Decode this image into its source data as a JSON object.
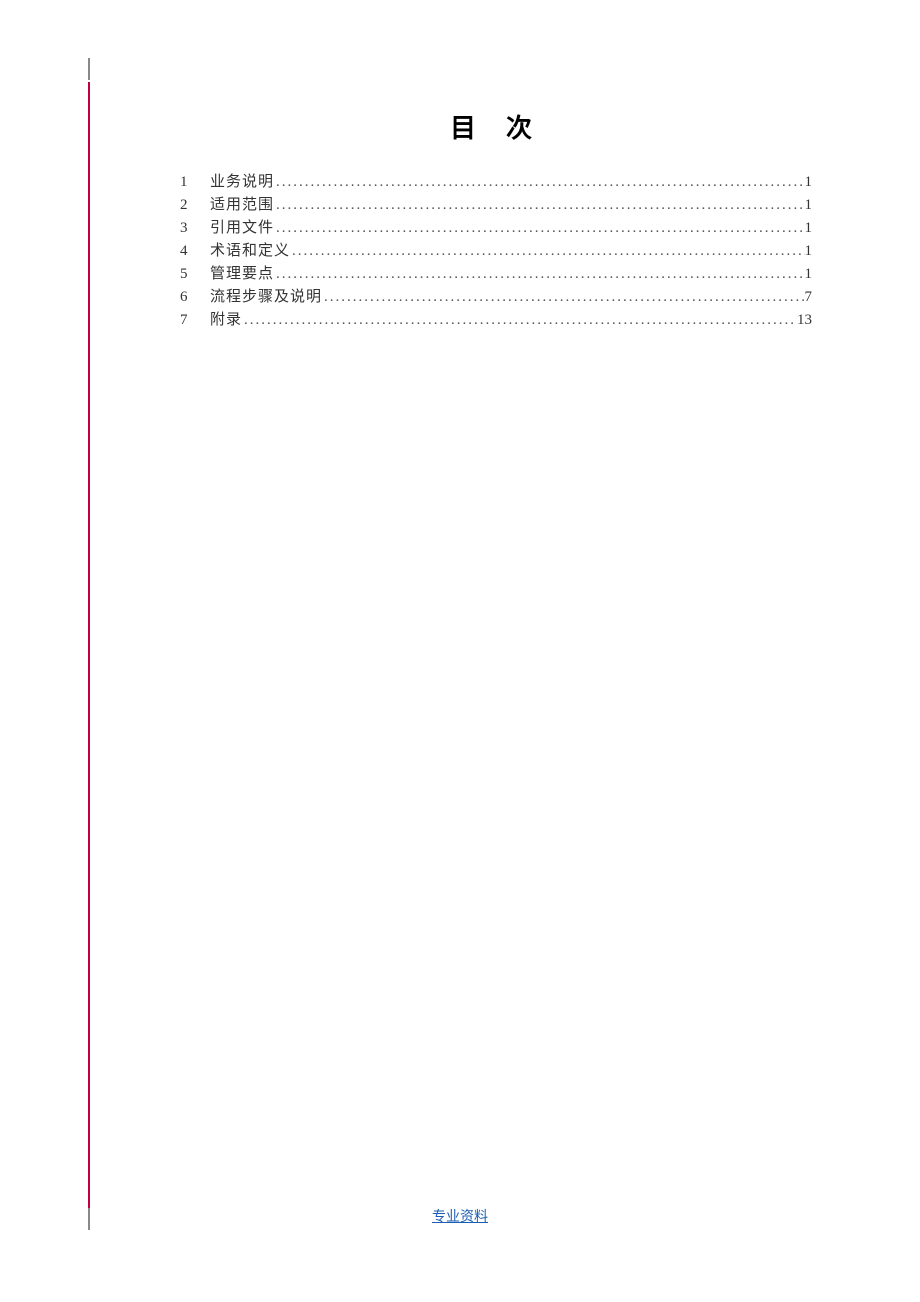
{
  "title": "目次",
  "toc": [
    {
      "num": "1",
      "label": "业务说明",
      "page": "1"
    },
    {
      "num": "2",
      "label": "适用范围",
      "page": "1"
    },
    {
      "num": "3",
      "label": "引用文件",
      "page": "1"
    },
    {
      "num": "4",
      "label": "术语和定义",
      "page": "1"
    },
    {
      "num": "5",
      "label": "管理要点",
      "page": "1"
    },
    {
      "num": "6",
      "label": "流程步骤及说明",
      "page": "7"
    },
    {
      "num": "7",
      "label": "附录",
      "page": "13"
    }
  ],
  "footer": "专业资料"
}
